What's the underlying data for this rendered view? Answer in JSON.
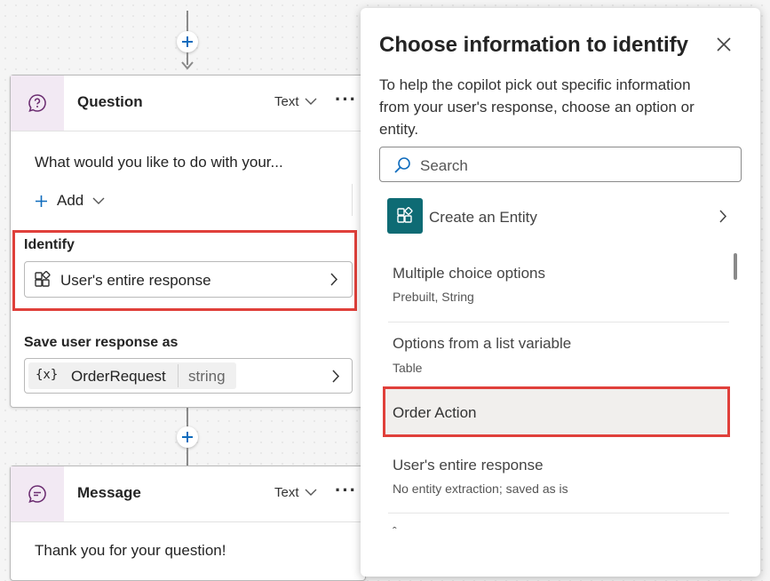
{
  "canvas": {
    "question_node": {
      "title": "Question",
      "type_label": "Text",
      "prompt_text": "What would you like to do with your...",
      "add_label": "Add",
      "identify_label": "Identify",
      "identify_value": "User's entire response",
      "save_label": "Save user response as",
      "variable_icon": "{x}",
      "variable_name": "OrderRequest",
      "variable_type": "string"
    },
    "message_node": {
      "title": "Message",
      "type_label": "Text",
      "message_text": "Thank you for your question!"
    }
  },
  "panel": {
    "title": "Choose information to identify",
    "description": "To help the copilot pick out specific information from your user's response, choose an option or entity.",
    "search_placeholder": "Search",
    "create_entity_label": "Create an Entity",
    "options": [
      {
        "name": "Multiple choice options",
        "sub": "Prebuilt, String"
      },
      {
        "name": "Options from a list variable",
        "sub": "Table"
      },
      {
        "name": "Order Action",
        "sub": ""
      },
      {
        "name": "User's entire response",
        "sub": "No entity extraction; saved as is"
      }
    ]
  },
  "colors": {
    "accent": "#0f6cbd",
    "teal": "#0e6b74",
    "node_icon_bg": "#f2e9f3",
    "node_icon": "#6b2c70",
    "highlight_red": "#e0403b",
    "selected_row_bg": "#f1efed"
  }
}
